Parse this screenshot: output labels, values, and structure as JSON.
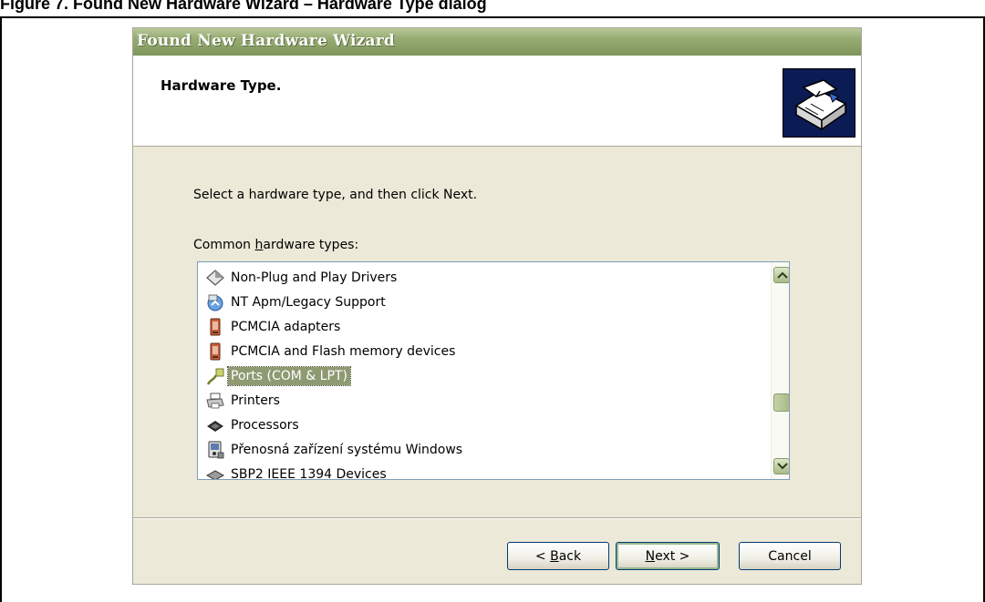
{
  "document": {
    "caption": "Figure 7.  Found New Hardware Wizard – Hardware Type dialog"
  },
  "wizard": {
    "title": "Found New Hardware Wizard",
    "header_title": "Hardware Type.",
    "header_icon": "hardware-box-icon",
    "instruction": "Select a hardware type, and then click Next.",
    "list_label_prefix": "Common ",
    "list_label_accel": "h",
    "list_label_suffix": "ardware types:",
    "items": [
      {
        "label": "Non-Plug and Play Drivers",
        "icon": "diamond-icon"
      },
      {
        "label": "NT Apm/Legacy Support",
        "icon": "power-icon"
      },
      {
        "label": "PCMCIA adapters",
        "icon": "pcmcia-card-icon"
      },
      {
        "label": "PCMCIA and Flash memory devices",
        "icon": "pcmcia-card-icon"
      },
      {
        "label": "Ports (COM & LPT)",
        "icon": "port-connector-icon",
        "selected": true
      },
      {
        "label": "Printers",
        "icon": "printer-icon"
      },
      {
        "label": "Processors",
        "icon": "processor-icon"
      },
      {
        "label": "Přenosná zařízení systému Windows",
        "icon": "portable-device-icon"
      },
      {
        "label": "SBP2 IEEE 1394 Devices",
        "icon": "ieee1394-icon"
      }
    ],
    "buttons": {
      "back_prefix": "< ",
      "back_accel": "B",
      "back_suffix": "ack",
      "next_accel": "N",
      "next_suffix": "ext >",
      "cancel": "Cancel"
    }
  }
}
